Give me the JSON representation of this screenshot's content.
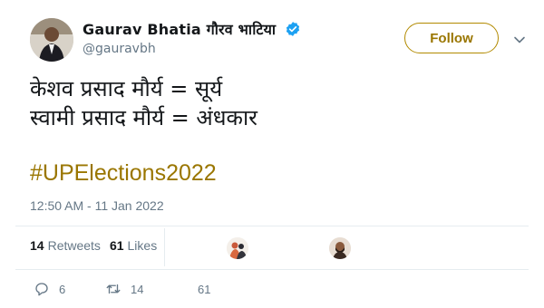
{
  "user": {
    "display_name": "Gaurav Bhatia गौरव भाटिया",
    "handle": "@gauravbh",
    "verified": true
  },
  "follow_button": {
    "label": "Follow"
  },
  "tweet": {
    "line1": "केशव प्रसाद मौर्य = सूर्य",
    "line2": "स्वामी प्रसाद मौर्य = अंधकार",
    "hashtag": "#UPElections2022",
    "timestamp": "12:50 AM - 11 Jan 2022"
  },
  "stats": {
    "retweets_count": "14",
    "retweets_label": "Retweets",
    "likes_count": "61",
    "likes_label": "Likes"
  },
  "actions": {
    "reply_count": "6",
    "retweet_count": "14",
    "like_count": "61"
  },
  "colors": {
    "accent": "#9a7600",
    "verified": "#1da1f2",
    "muted": "#657786",
    "divider": "#e6ecf0"
  }
}
